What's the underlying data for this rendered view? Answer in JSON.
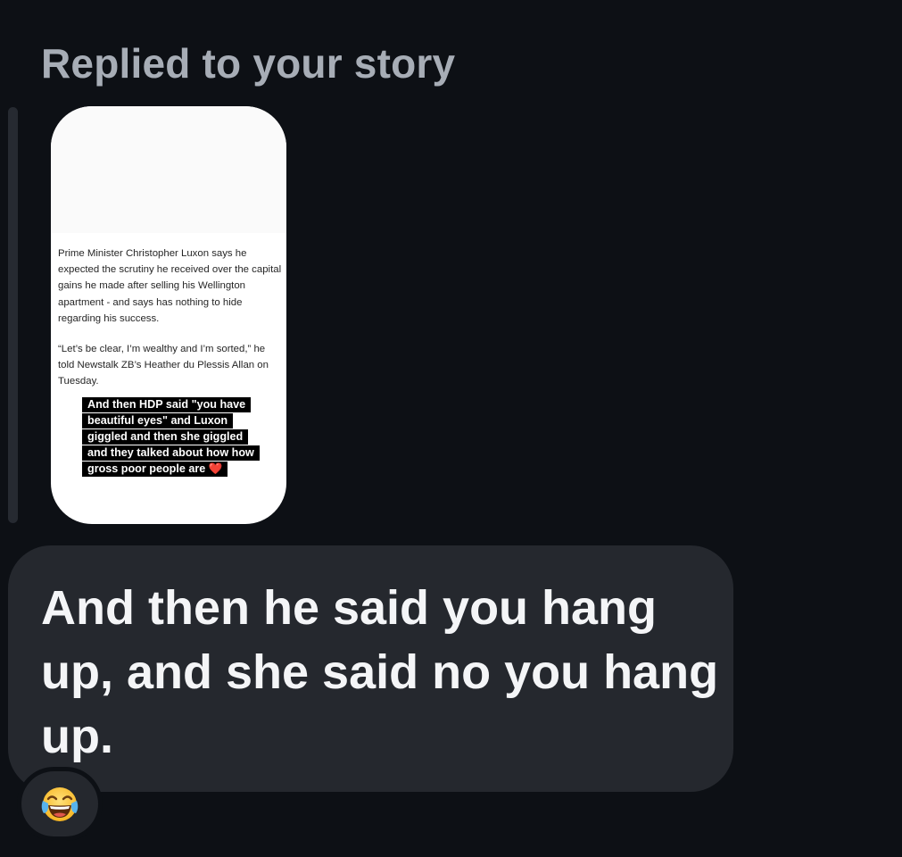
{
  "header": {
    "replied_label": "Replied to your story"
  },
  "story": {
    "paragraph_1": "Prime Minister Christopher Luxon says he expected the scrutiny he received over the capital gains he made after selling his Wellington apartment - and says has nothing to hide regarding his success.",
    "paragraph_2": "“Let’s be clear, I’m wealthy and I’m sorted,” he told Newstalk ZB’s Heather du Plessis Allan on Tuesday.",
    "sticker_lines": [
      "And then HDP said \"you have",
      "beautiful eyes\" and Luxon",
      "giggled and then she giggled",
      "and they talked about how how",
      "gross poor people are ❤️"
    ]
  },
  "message": {
    "text": "And then he said you hang up, and she said no you hang up."
  },
  "reaction": {
    "emoji_icon": "face-with-tears-of-joy-icon"
  },
  "colors": {
    "background": "#0d1015",
    "bubble": "#25282e",
    "header_text": "#a7adb6",
    "message_text": "#f4f5f7"
  }
}
